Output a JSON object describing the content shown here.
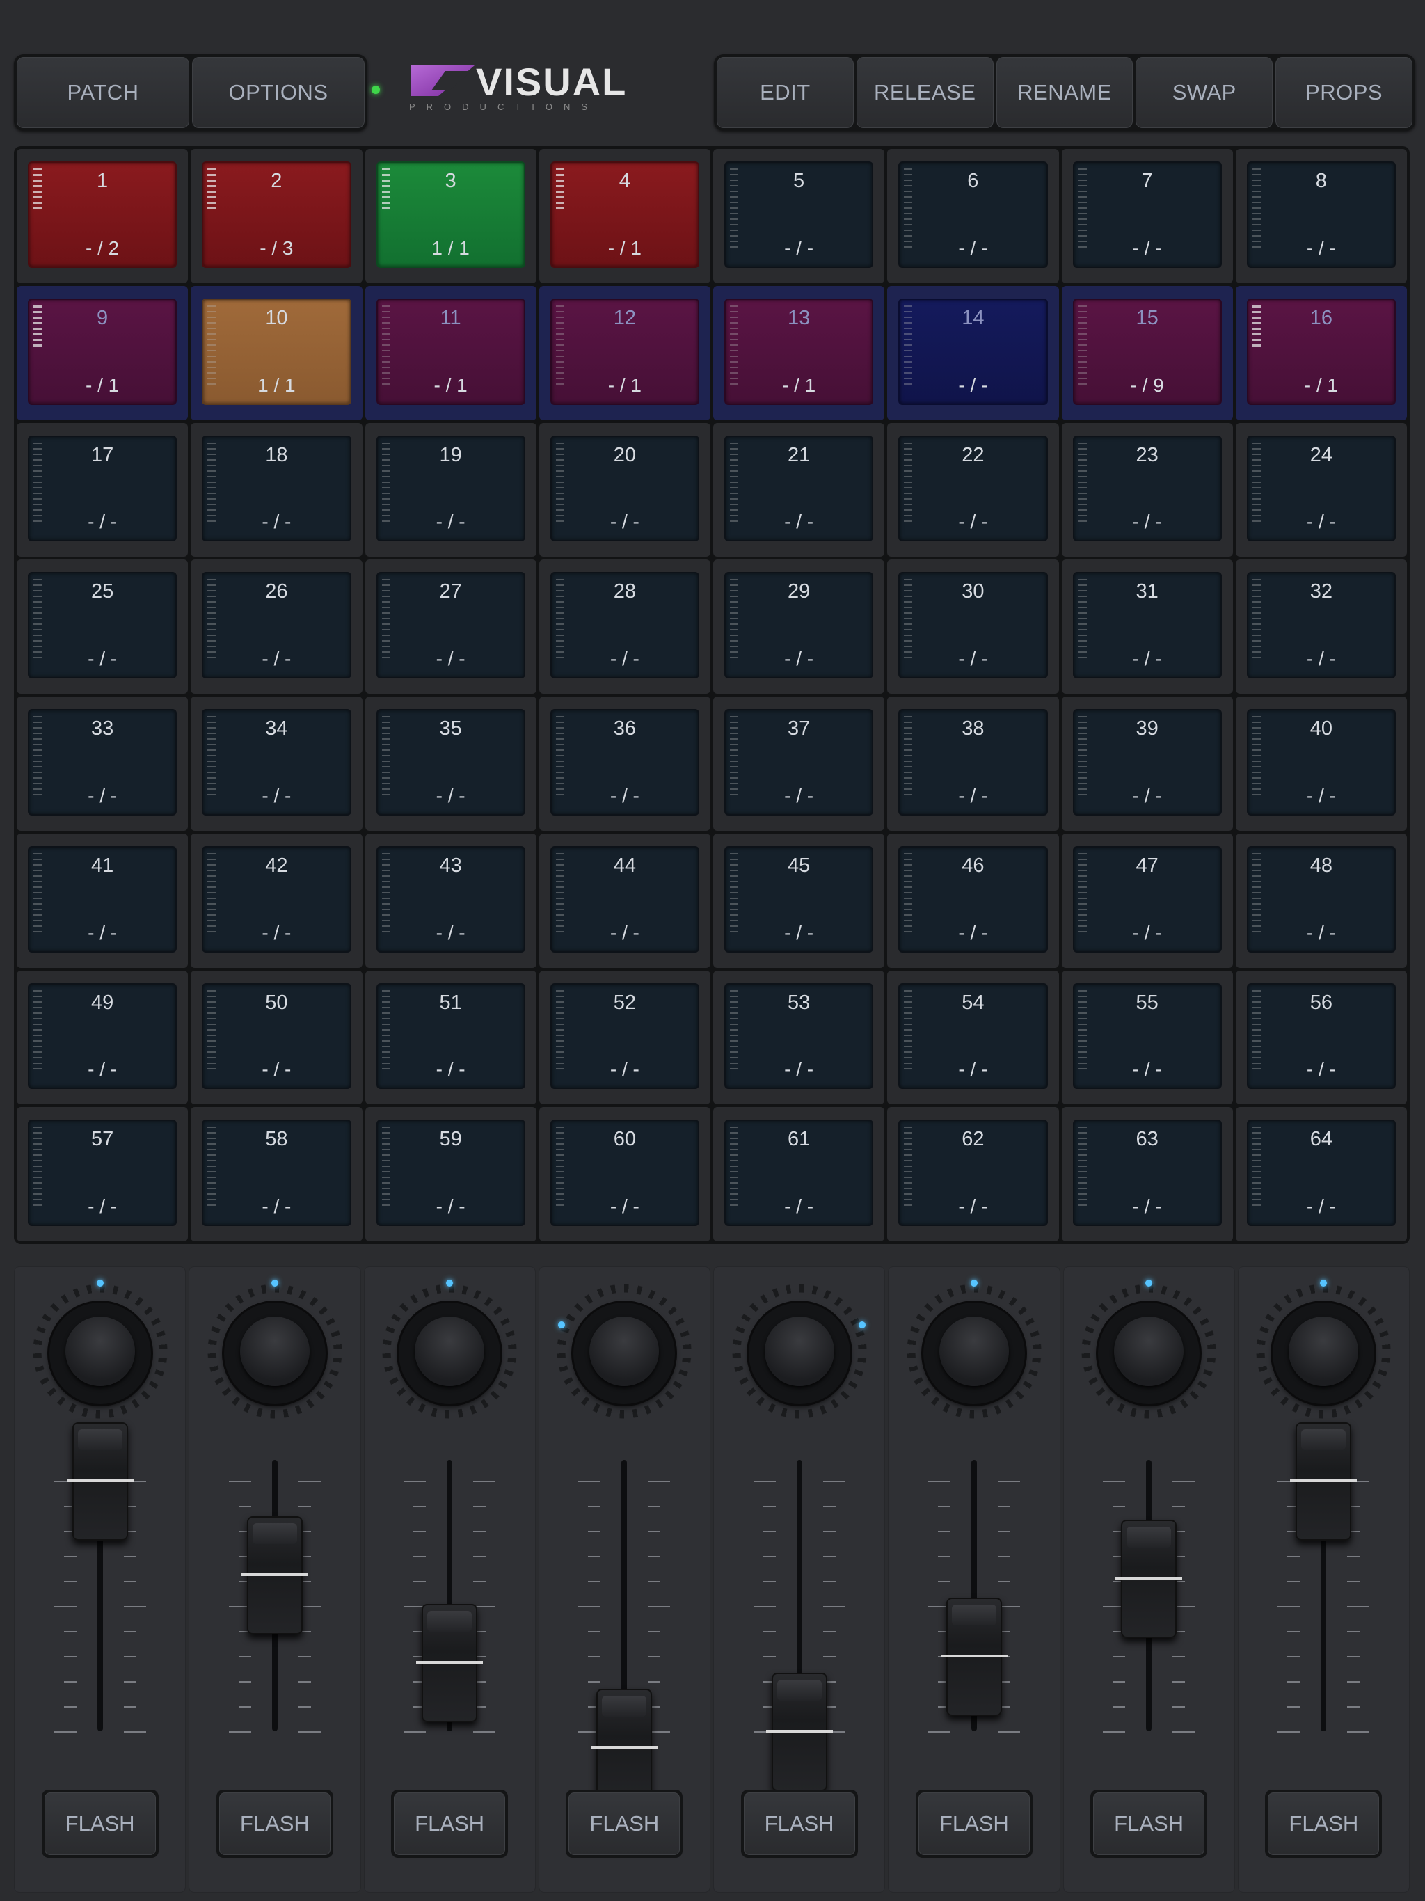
{
  "header": {
    "left_buttons": [
      "PATCH",
      "OPTIONS"
    ],
    "right_buttons": [
      "EDIT",
      "RELEASE",
      "RENAME",
      "SWAP",
      "PROPS"
    ],
    "logo": {
      "name": "VISUAL",
      "sub": "PRODUCTIONS"
    },
    "status_led": "green"
  },
  "colors": {
    "red": "#7a161a",
    "green": "#167d35",
    "purple": "#50123e",
    "orange": "#96623a",
    "navy": "#121758",
    "selected_row": "#1e2350",
    "knob_led": "#56c4ff"
  },
  "pads": [
    {
      "num": "1",
      "count": "- / 2",
      "color": "red",
      "meter": true
    },
    {
      "num": "2",
      "count": "- / 3",
      "color": "red",
      "meter": true
    },
    {
      "num": "3",
      "count": "1 / 1",
      "color": "green",
      "meter": true
    },
    {
      "num": "4",
      "count": "- / 1",
      "color": "red",
      "meter": true
    },
    {
      "num": "5",
      "count": "- / -"
    },
    {
      "num": "6",
      "count": "- / -"
    },
    {
      "num": "7",
      "count": "- / -"
    },
    {
      "num": "8",
      "count": "- / -"
    },
    {
      "num": "9",
      "count": "- / 1",
      "color": "purple",
      "meter": true
    },
    {
      "num": "10",
      "count": "1 / 1",
      "color": "orange"
    },
    {
      "num": "11",
      "count": "- / 1",
      "color": "purple"
    },
    {
      "num": "12",
      "count": "- / 1",
      "color": "purple"
    },
    {
      "num": "13",
      "count": "- / 1",
      "color": "purple"
    },
    {
      "num": "14",
      "count": "- / -",
      "color": "navy"
    },
    {
      "num": "15",
      "count": "- / 9",
      "color": "purple"
    },
    {
      "num": "16",
      "count": "- / 1",
      "color": "purple",
      "meter": true
    },
    {
      "num": "17",
      "count": "- / -"
    },
    {
      "num": "18",
      "count": "- / -"
    },
    {
      "num": "19",
      "count": "- / -"
    },
    {
      "num": "20",
      "count": "- / -"
    },
    {
      "num": "21",
      "count": "- / -"
    },
    {
      "num": "22",
      "count": "- / -"
    },
    {
      "num": "23",
      "count": "- / -"
    },
    {
      "num": "24",
      "count": "- / -"
    },
    {
      "num": "25",
      "count": "- / -"
    },
    {
      "num": "26",
      "count": "- / -"
    },
    {
      "num": "27",
      "count": "- / -"
    },
    {
      "num": "28",
      "count": "- / -"
    },
    {
      "num": "29",
      "count": "- / -"
    },
    {
      "num": "30",
      "count": "- / -"
    },
    {
      "num": "31",
      "count": "- / -"
    },
    {
      "num": "32",
      "count": "- / -"
    },
    {
      "num": "33",
      "count": "- / -"
    },
    {
      "num": "34",
      "count": "- / -"
    },
    {
      "num": "35",
      "count": "- / -"
    },
    {
      "num": "36",
      "count": "- / -"
    },
    {
      "num": "37",
      "count": "- / -"
    },
    {
      "num": "38",
      "count": "- / -"
    },
    {
      "num": "39",
      "count": "- / -"
    },
    {
      "num": "40",
      "count": "- / -"
    },
    {
      "num": "41",
      "count": "- / -"
    },
    {
      "num": "42",
      "count": "- / -"
    },
    {
      "num": "43",
      "count": "- / -"
    },
    {
      "num": "44",
      "count": "- / -"
    },
    {
      "num": "45",
      "count": "- / -"
    },
    {
      "num": "46",
      "count": "- / -"
    },
    {
      "num": "47",
      "count": "- / -"
    },
    {
      "num": "48",
      "count": "- / -"
    },
    {
      "num": "49",
      "count": "- / -"
    },
    {
      "num": "50",
      "count": "- / -"
    },
    {
      "num": "51",
      "count": "- / -"
    },
    {
      "num": "52",
      "count": "- / -"
    },
    {
      "num": "53",
      "count": "- / -"
    },
    {
      "num": "54",
      "count": "- / -"
    },
    {
      "num": "55",
      "count": "- / -"
    },
    {
      "num": "56",
      "count": "- / -"
    },
    {
      "num": "57",
      "count": "- / -"
    },
    {
      "num": "58",
      "count": "- / -"
    },
    {
      "num": "59",
      "count": "- / -"
    },
    {
      "num": "60",
      "count": "- / -"
    },
    {
      "num": "61",
      "count": "- / -"
    },
    {
      "num": "62",
      "count": "- / -"
    },
    {
      "num": "63",
      "count": "- / -"
    },
    {
      "num": "64",
      "count": "- / -"
    }
  ],
  "selected_row": 1,
  "mixer": {
    "flash_label": "FLASH",
    "channels": [
      {
        "fader_level": 1.0,
        "knob_level": 0.5
      },
      {
        "fader_level": 0.7,
        "knob_level": 0.5
      },
      {
        "fader_level": 0.42,
        "knob_level": 0.5
      },
      {
        "fader_level": 0.15,
        "knob_level": 0.25
      },
      {
        "fader_level": 0.2,
        "knob_level": 0.75
      },
      {
        "fader_level": 0.44,
        "knob_level": 0.5
      },
      {
        "fader_level": 0.69,
        "knob_level": 0.5
      },
      {
        "fader_level": 1.0,
        "knob_level": 0.5
      }
    ]
  }
}
